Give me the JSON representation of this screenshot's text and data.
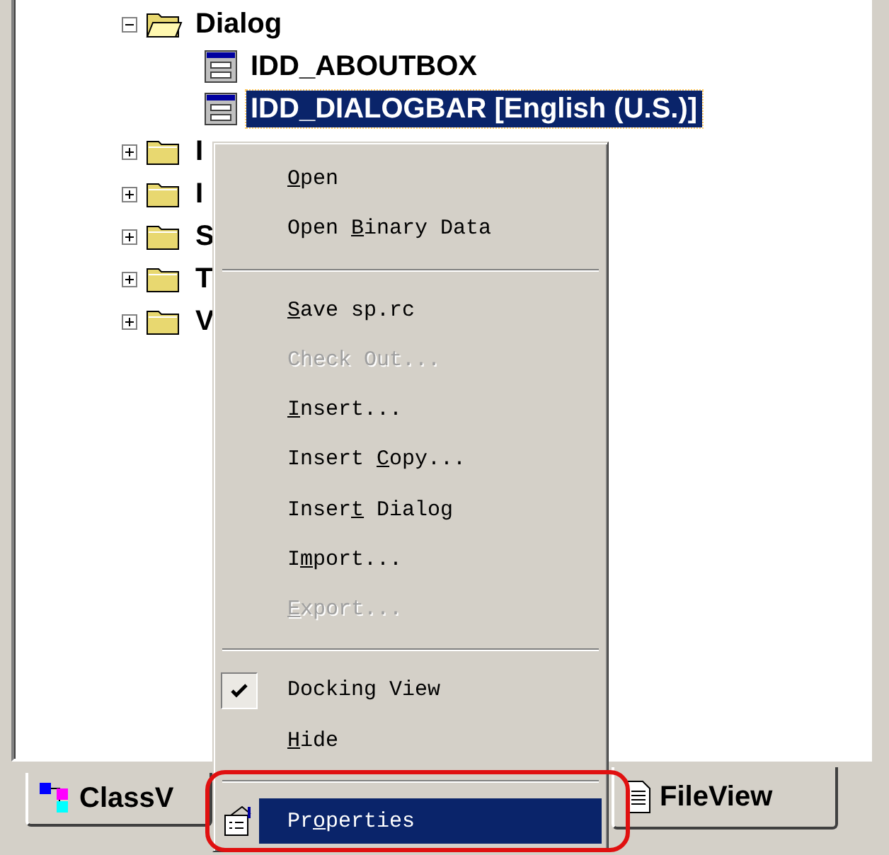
{
  "tree": [
    {
      "label": "Dialog",
      "kind": "folder",
      "expanded": true,
      "selected": false,
      "children": [
        {
          "label": "IDD_ABOUTBOX",
          "kind": "dialog",
          "selected": false
        },
        {
          "label": "IDD_DIALOGBAR [English (U.S.)]",
          "kind": "dialog",
          "selected": true
        }
      ]
    },
    {
      "label": "I",
      "kind": "folder",
      "expanded": false,
      "selected": false
    },
    {
      "label": "I",
      "kind": "folder",
      "expanded": false,
      "selected": false
    },
    {
      "label": "S",
      "kind": "folder",
      "expanded": false,
      "selected": false
    },
    {
      "label": "T",
      "kind": "folder",
      "expanded": false,
      "selected": false
    },
    {
      "label": "V",
      "kind": "folder",
      "expanded": false,
      "selected": false
    }
  ],
  "context_menu": [
    {
      "kind": "item",
      "label": [
        {
          "text": "O",
          "underlined": true
        },
        {
          "text": "pen",
          "underlined": false
        }
      ],
      "disabled": false,
      "checked": false,
      "selected": false
    },
    {
      "kind": "item",
      "label": [
        {
          "text": "Open ",
          "underlined": false
        },
        {
          "text": "B",
          "underlined": true
        },
        {
          "text": "inary Data",
          "underlined": false
        }
      ],
      "disabled": false,
      "checked": false,
      "selected": false
    },
    {
      "kind": "separator"
    },
    {
      "kind": "item",
      "label": [
        {
          "text": "S",
          "underlined": true
        },
        {
          "text": "ave sp.rc",
          "underlined": false
        }
      ],
      "disabled": false,
      "checked": false,
      "selected": false
    },
    {
      "kind": "item",
      "label": [
        {
          "text": "Check Out...",
          "underlined": false
        }
      ],
      "disabled": true,
      "checked": false,
      "selected": false
    },
    {
      "kind": "item",
      "label": [
        {
          "text": "I",
          "underlined": true
        },
        {
          "text": "nsert...",
          "underlined": false
        }
      ],
      "disabled": false,
      "checked": false,
      "selected": false
    },
    {
      "kind": "item",
      "label": [
        {
          "text": "Insert ",
          "underlined": false
        },
        {
          "text": "C",
          "underlined": true
        },
        {
          "text": "opy...",
          "underlined": false
        }
      ],
      "disabled": false,
      "checked": false,
      "selected": false
    },
    {
      "kind": "item",
      "label": [
        {
          "text": "Inser",
          "underlined": false
        },
        {
          "text": "t",
          "underlined": true
        },
        {
          "text": " Dialog",
          "underlined": false
        }
      ],
      "disabled": false,
      "checked": false,
      "selected": false
    },
    {
      "kind": "item",
      "label": [
        {
          "text": "I",
          "underlined": false
        },
        {
          "text": "m",
          "underlined": true
        },
        {
          "text": "port...",
          "underlined": false
        }
      ],
      "disabled": false,
      "checked": false,
      "selected": false
    },
    {
      "kind": "item",
      "label": [
        {
          "text": "E",
          "underlined": true
        },
        {
          "text": "xport...",
          "underlined": false
        }
      ],
      "disabled": true,
      "checked": false,
      "selected": false
    },
    {
      "kind": "separator"
    },
    {
      "kind": "item",
      "label": [
        {
          "text": "Docking View",
          "underlined": false
        }
      ],
      "disabled": false,
      "checked": true,
      "selected": false
    },
    {
      "kind": "item",
      "label": [
        {
          "text": "H",
          "underlined": true
        },
        {
          "text": "ide",
          "underlined": false
        }
      ],
      "disabled": false,
      "checked": false,
      "selected": false
    },
    {
      "kind": "separator"
    },
    {
      "kind": "icon_item",
      "label": [
        {
          "text": "Pr",
          "underlined": false
        },
        {
          "text": "o",
          "underlined": true
        },
        {
          "text": "perties",
          "underlined": false
        }
      ],
      "disabled": false,
      "checked": false,
      "selected": true,
      "annotated": true
    }
  ],
  "tabs": [
    {
      "label": "ClassV",
      "kind": "class",
      "selected": false
    },
    {
      "label": "FileView",
      "kind": "file",
      "selected": true
    }
  ]
}
